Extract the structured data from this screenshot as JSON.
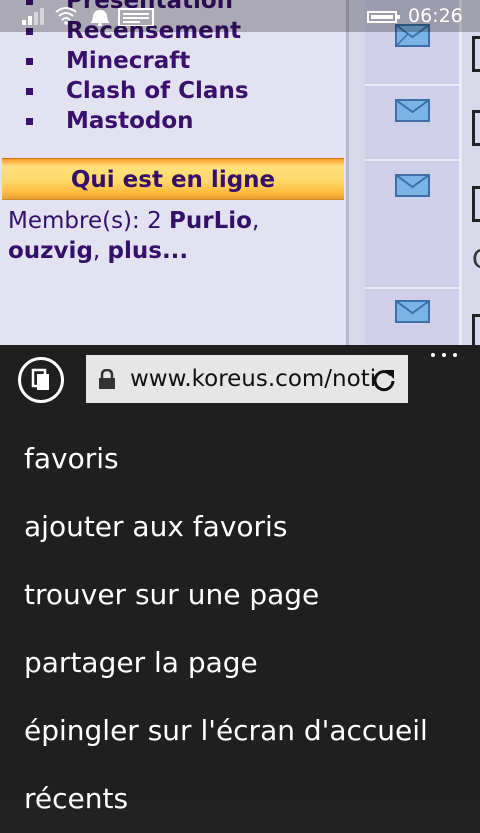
{
  "status_bar": {
    "time": "06:26",
    "icons": [
      "signal-icon",
      "wifi-icon",
      "notification-bell-icon",
      "message-icon",
      "battery-icon"
    ]
  },
  "page": {
    "nav_links": [
      "Présentation",
      "Recensement",
      "Minecraft",
      "Clash of Clans",
      "Mastodon"
    ],
    "online_heading": "Qui est en ligne",
    "members_prefix": "Membre(s): 2 ",
    "member_1": "PurLio",
    "separator_1": ",",
    "member_2": "ouzvig",
    "separator_2": ", ",
    "more_link": "plus...",
    "right_edge_letter": "C",
    "colors": {
      "link": "#3a106e",
      "banner": "#ffd86a",
      "background": "#e3e2f1"
    }
  },
  "browser": {
    "url": "www.koreus.com/noti",
    "menu_items": [
      "favoris",
      "ajouter aux favoris",
      "trouver sur une page",
      "partager la page",
      "épingler sur l'écran d'accueil",
      "récents"
    ],
    "colors": {
      "menu_bg": "#1f1f1f",
      "address_bg": "#e6e6e6"
    }
  }
}
